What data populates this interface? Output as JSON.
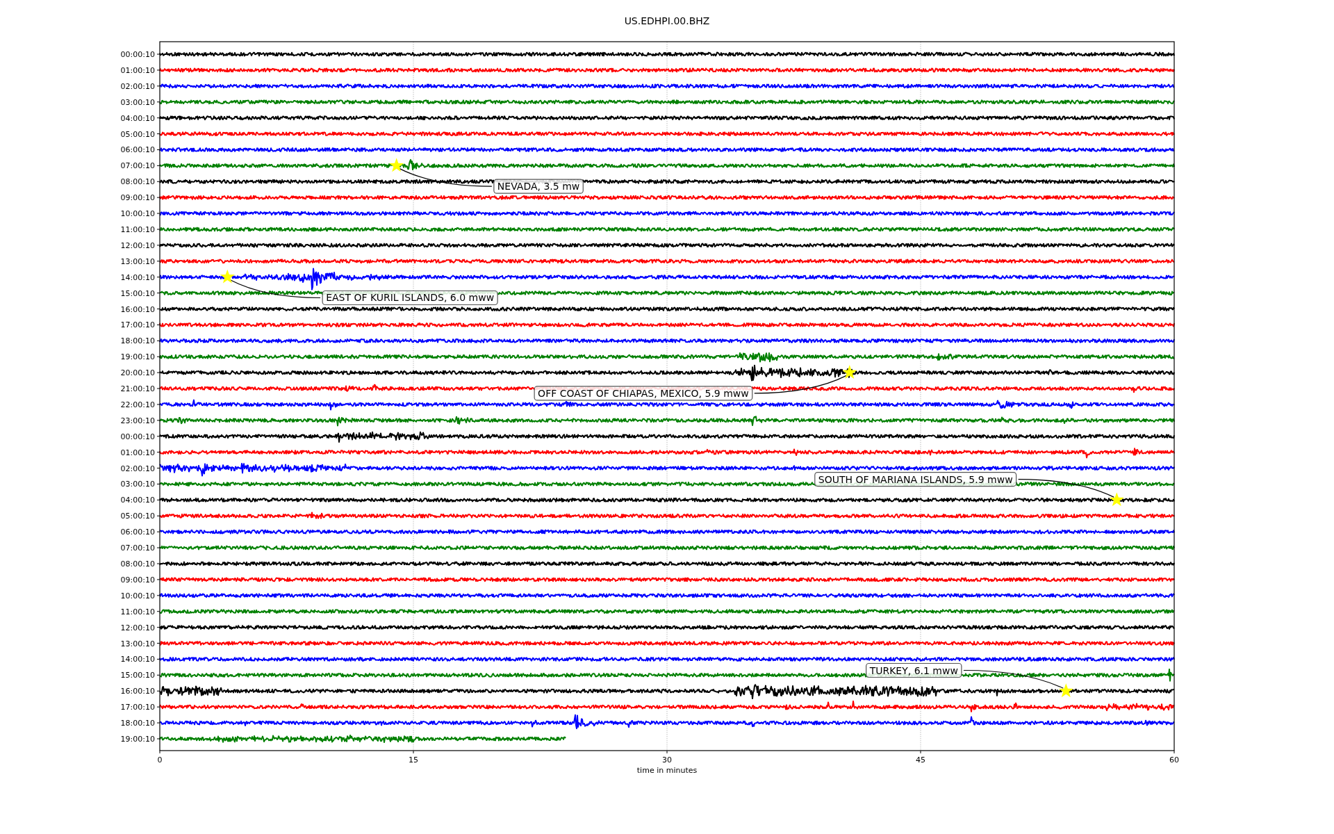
{
  "figure": {
    "title": "US.EDHPI.00.BHZ",
    "plot": {
      "xlabel": "time in minutes",
      "xticks": [
        "0",
        "15",
        "30",
        "45",
        "60"
      ],
      "traces": [
        {
          "label": "00:00:10",
          "color": "#000000"
        },
        {
          "label": "01:00:10",
          "color": "#ff0000"
        },
        {
          "label": "02:00:10",
          "color": "#0000ff"
        },
        {
          "label": "03:00:10",
          "color": "#008000"
        },
        {
          "label": "04:00:10",
          "color": "#000000"
        },
        {
          "label": "05:00:10",
          "color": "#ff0000"
        },
        {
          "label": "06:00:10",
          "color": "#0000ff"
        },
        {
          "label": "07:00:10",
          "color": "#008000"
        },
        {
          "label": "08:00:10",
          "color": "#000000"
        },
        {
          "label": "09:00:10",
          "color": "#ff0000"
        },
        {
          "label": "10:00:10",
          "color": "#0000ff"
        },
        {
          "label": "11:00:10",
          "color": "#008000"
        },
        {
          "label": "12:00:10",
          "color": "#000000"
        },
        {
          "label": "13:00:10",
          "color": "#ff0000"
        },
        {
          "label": "14:00:10",
          "color": "#0000ff"
        },
        {
          "label": "15:00:10",
          "color": "#008000"
        },
        {
          "label": "16:00:10",
          "color": "#000000"
        },
        {
          "label": "17:00:10",
          "color": "#ff0000"
        },
        {
          "label": "18:00:10",
          "color": "#0000ff"
        },
        {
          "label": "19:00:10",
          "color": "#008000"
        },
        {
          "label": "20:00:10",
          "color": "#000000"
        },
        {
          "label": "21:00:10",
          "color": "#ff0000"
        },
        {
          "label": "22:00:10",
          "color": "#0000ff"
        },
        {
          "label": "23:00:10",
          "color": "#008000"
        },
        {
          "label": "00:00:10",
          "color": "#000000"
        },
        {
          "label": "01:00:10",
          "color": "#ff0000"
        },
        {
          "label": "02:00:10",
          "color": "#0000ff"
        },
        {
          "label": "03:00:10",
          "color": "#008000"
        },
        {
          "label": "04:00:10",
          "color": "#000000"
        },
        {
          "label": "05:00:10",
          "color": "#ff0000"
        },
        {
          "label": "06:00:10",
          "color": "#0000ff"
        },
        {
          "label": "07:00:10",
          "color": "#008000"
        },
        {
          "label": "08:00:10",
          "color": "#000000"
        },
        {
          "label": "09:00:10",
          "color": "#ff0000"
        },
        {
          "label": "10:00:10",
          "color": "#0000ff"
        },
        {
          "label": "11:00:10",
          "color": "#008000"
        },
        {
          "label": "12:00:10",
          "color": "#000000"
        },
        {
          "label": "13:00:10",
          "color": "#ff0000"
        },
        {
          "label": "14:00:10",
          "color": "#0000ff"
        },
        {
          "label": "15:00:10",
          "color": "#008000"
        },
        {
          "label": "16:00:10",
          "color": "#000000"
        },
        {
          "label": "17:00:10",
          "color": "#ff0000"
        },
        {
          "label": "18:00:10",
          "color": "#0000ff"
        },
        {
          "label": "19:00:10",
          "color": "#008000",
          "level": 0.4
        }
      ],
      "events": [
        {
          "label": "NEVADA, 3.5 mw"
        },
        {
          "label": "EAST OF KURIL ISLANDS, 6.0 mww"
        },
        {
          "label": "OFF COAST OF CHIAPAS, MEXICO, 5.9 mww"
        },
        {
          "label": "SOUTH OF MARIANA ISLANDS, 5.9 mww"
        },
        {
          "label": "TURKEY, 6.1 mww"
        }
      ]
    }
  }
}
